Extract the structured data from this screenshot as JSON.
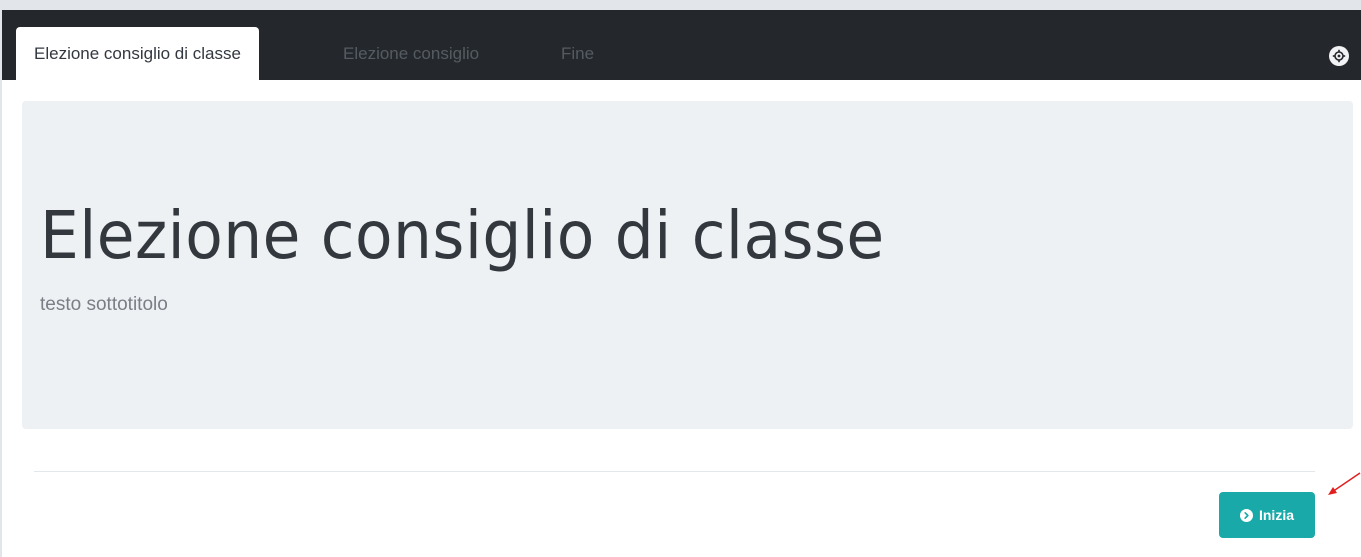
{
  "tabs": [
    {
      "label": "Elezione consiglio di classe",
      "active": true
    },
    {
      "label": "Elezione consiglio",
      "active": false
    },
    {
      "label": "Fine",
      "active": false
    }
  ],
  "header": {
    "settings_icon": "settings-icon"
  },
  "jumbotron": {
    "title": "Elezione consiglio di classe",
    "subtitle": "testo sottotitolo"
  },
  "actions": {
    "start_label": "Inizia",
    "start_icon": "chevron-circle-right-icon"
  },
  "colors": {
    "topbar": "#24282d",
    "jumbotron": "#eef1f4",
    "accent": "#1aa9a9",
    "annotation": "#e02020"
  }
}
